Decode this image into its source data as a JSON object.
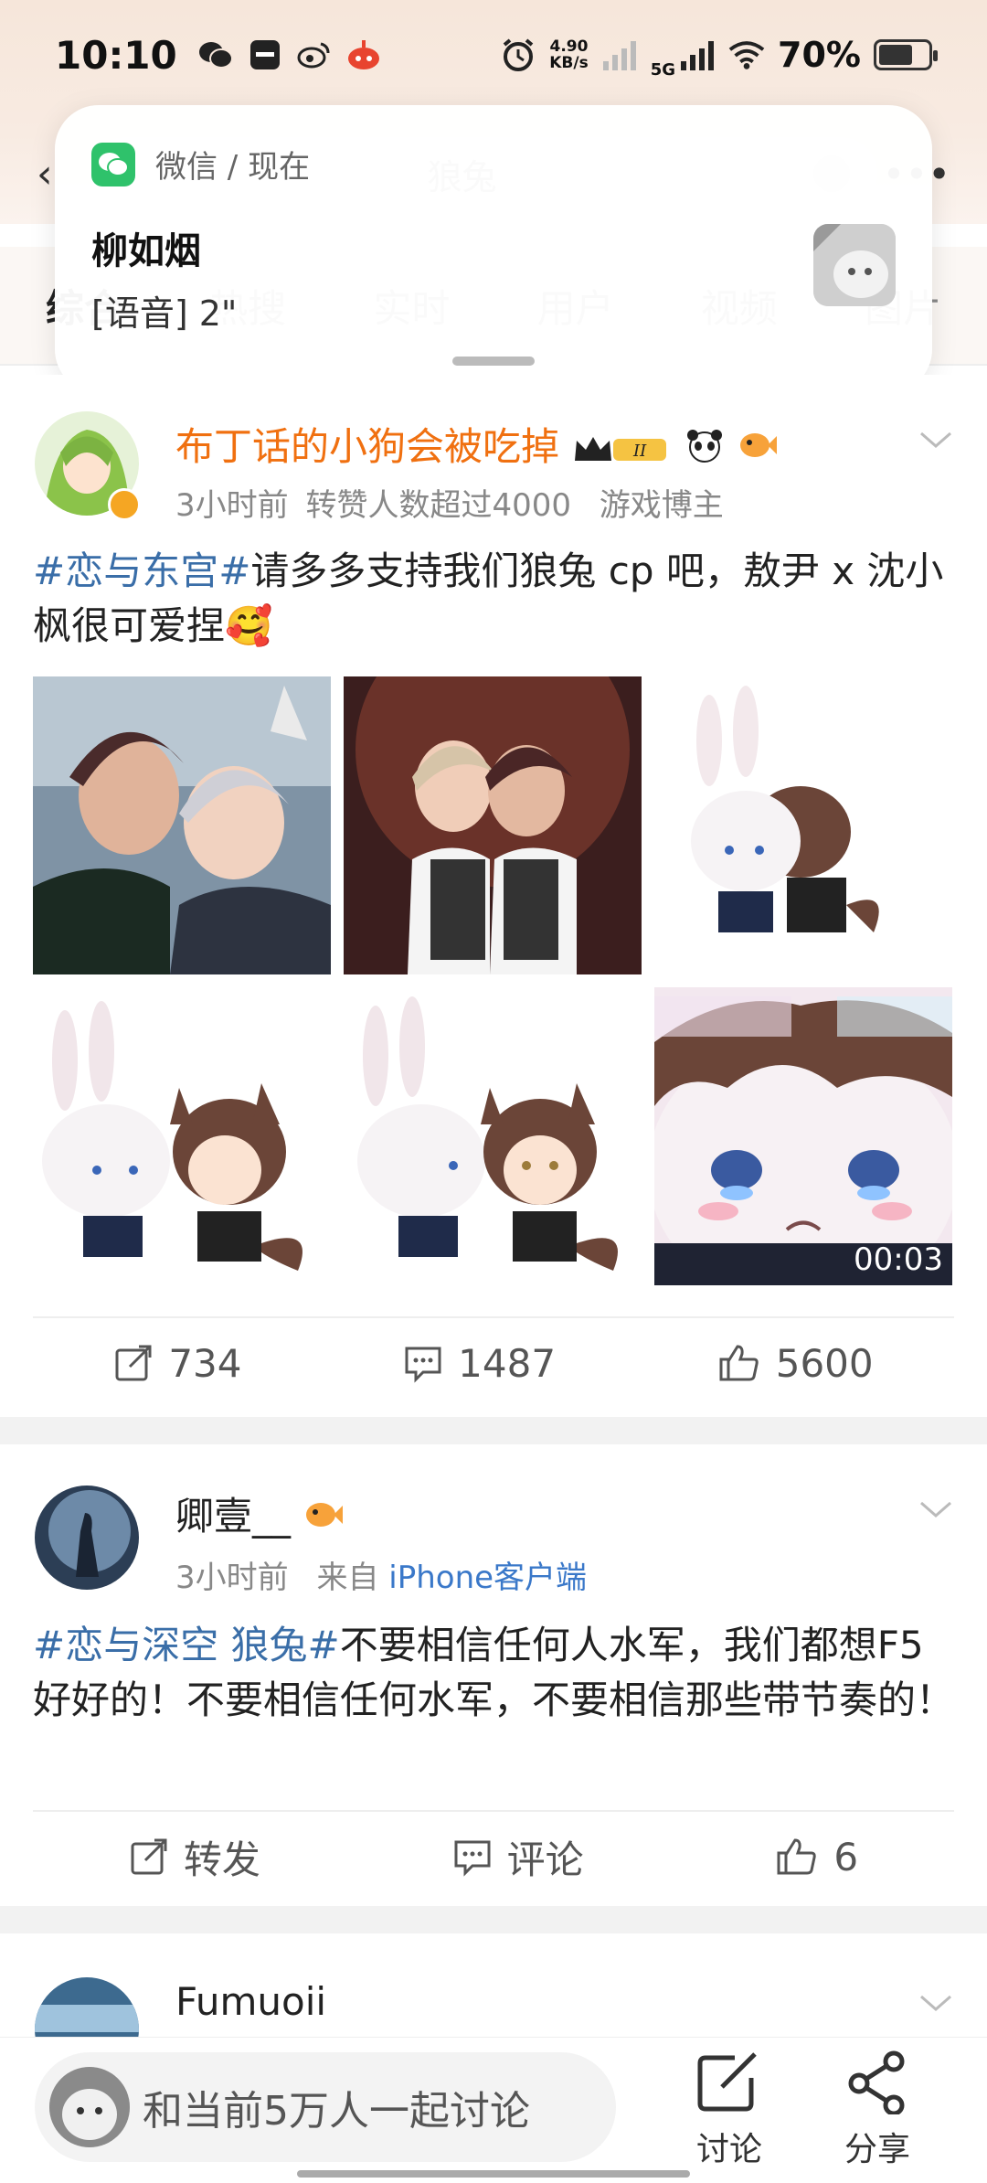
{
  "status_bar": {
    "time": "10:10",
    "net_speed_value": "4.90",
    "net_speed_unit": "KB/s",
    "network": "5G",
    "battery_percent": "70%",
    "battery_level": 0.7
  },
  "search": {
    "query": "狼兔"
  },
  "tabs": [
    {
      "label": "综合",
      "active": true
    },
    {
      "label": "热搜"
    },
    {
      "label": "实时"
    },
    {
      "label": "用户"
    },
    {
      "label": "视频"
    },
    {
      "label": "图片"
    }
  ],
  "notification": {
    "app": "微信 / 现在",
    "title": "柳如烟",
    "body": "[语音] 2\""
  },
  "posts": [
    {
      "author": "布丁话的小狗会被吃掉",
      "meta_time": "3小时前",
      "meta_extra": "转赞人数超过4000",
      "meta_role": "游戏博主",
      "hashtag": "#恋与东宫#",
      "text": "请多多支持我们狼兔 cp 吧，敖尹 x 沈小枫很可爱捏🥰",
      "video_duration": "00:03",
      "repost_count": "734",
      "comment_count": "1487",
      "like_count": "5600"
    },
    {
      "author": "卿壹__",
      "meta_time": "3小时前",
      "meta_from": "来自",
      "meta_client": "iPhone客户端",
      "hashtag": "#恋与深空 狼兔#",
      "text": "不要相信任何人水军，我们都想F5好好的！不要相信任何水军，不要相信那些带节奏的！",
      "repost_label": "转发",
      "comment_label": "评论",
      "like_count": "6"
    },
    {
      "author": "Fumuoii"
    }
  ],
  "bottom_bar": {
    "discuss_placeholder": "和当前5万人一起讨论",
    "discuss_label": "讨论",
    "share_label": "分享"
  }
}
